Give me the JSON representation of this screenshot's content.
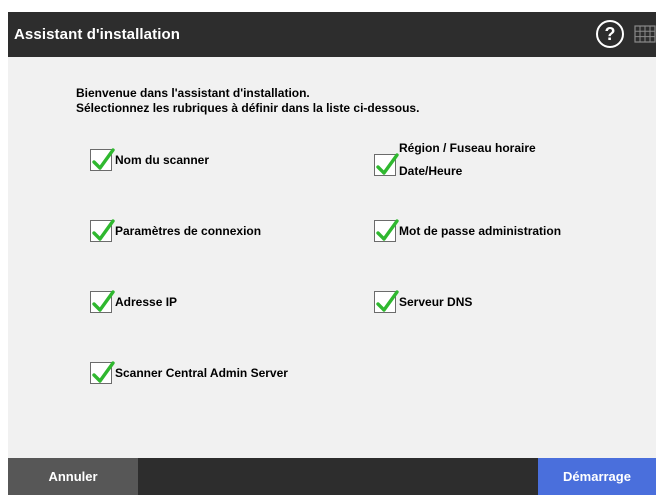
{
  "window": {
    "title": "Assistant d'installation",
    "help_icon": "help-circle-icon",
    "keyboard_icon": "keyboard-icon"
  },
  "intro": {
    "line1": "Bienvenue dans l'assistant d'installation.",
    "line2": "Sélectionnez les rubriques à définir dans la liste ci-dessous."
  },
  "options": [
    {
      "label": "Nom du scanner",
      "checked": true
    },
    {
      "label_line1": "Région / Fuseau horaire",
      "label_line2": "Date/Heure",
      "checked": true
    },
    {
      "label": "Paramètres de connexion",
      "checked": true
    },
    {
      "label": "Mot de passe administration",
      "checked": true
    },
    {
      "label": "Adresse IP",
      "checked": true
    },
    {
      "label": "Serveur DNS",
      "checked": true
    },
    {
      "label": "Scanner Central Admin Server",
      "checked": true
    }
  ],
  "footer": {
    "cancel_label": "Annuler",
    "start_label": "Démarrage"
  },
  "colors": {
    "titlebar": "#2d2d2d",
    "content_bg": "#f1f1f1",
    "check": "#2fb82f",
    "primary_button": "#4a6fdc",
    "secondary_button": "#575757"
  }
}
